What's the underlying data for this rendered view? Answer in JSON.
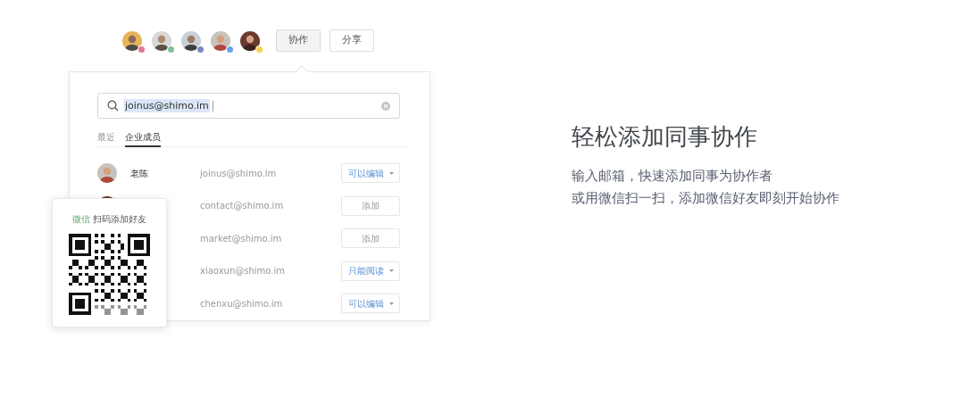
{
  "collaborators": [
    {
      "color": "#e57399"
    },
    {
      "color": "#7fbf9a"
    },
    {
      "color": "#7b84c4"
    },
    {
      "color": "#6fa0e8"
    },
    {
      "color": "#f5d04a"
    }
  ],
  "top_buttons": [
    {
      "label": "协作",
      "selected": true
    },
    {
      "label": "分享",
      "selected": false
    }
  ],
  "search": {
    "value": "joinus@shimo.im"
  },
  "tabs": [
    {
      "label": "最近",
      "selected": false
    },
    {
      "label": "企业成员",
      "selected": true
    }
  ],
  "members": [
    {
      "name": "老陈",
      "email": "joinus@shimo.im",
      "action": {
        "kind": "dropdown",
        "label": "可以编辑"
      }
    },
    {
      "email": "contact@shimo.im",
      "action": {
        "kind": "button",
        "label": "添加"
      }
    },
    {
      "email": "market@shimo.im",
      "action": {
        "kind": "button",
        "label": "添加"
      }
    },
    {
      "email": "xiaoxun@shimo.im",
      "action": {
        "kind": "dropdown",
        "label": "只能阅读"
      }
    },
    {
      "email": "chenxu@shimo.im",
      "action": {
        "kind": "dropdown",
        "label": "可以编辑"
      }
    }
  ],
  "wechat_card": {
    "brand": "微信",
    "text": "扫码添加好友"
  },
  "feature": {
    "title": "轻松添加同事协作",
    "lines": [
      "输入邮箱，快速添加同事为协作者",
      "或用微信扫一扫，添加微信好友即刻开始协作"
    ]
  }
}
